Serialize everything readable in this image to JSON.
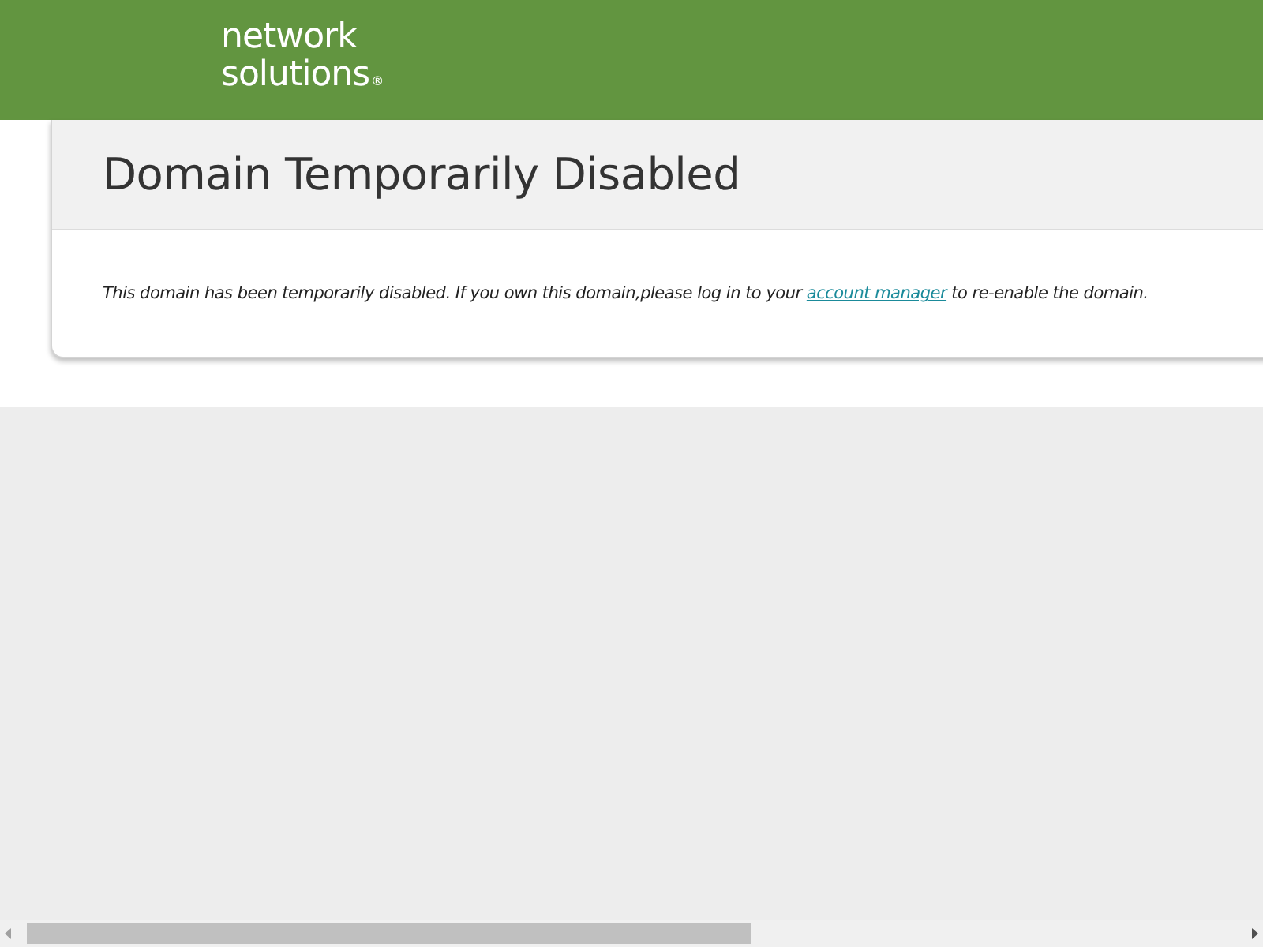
{
  "header": {
    "logo_lines": [
      "network",
      "solutions"
    ],
    "logo_mark": "®"
  },
  "notice": {
    "title": "Domain Temporarily Disabled",
    "message_before": "This domain has been temporarily disabled. If you own this domain,please log in to your ",
    "link": "account manager",
    "message_after": " to re-enable the domain."
  }
}
